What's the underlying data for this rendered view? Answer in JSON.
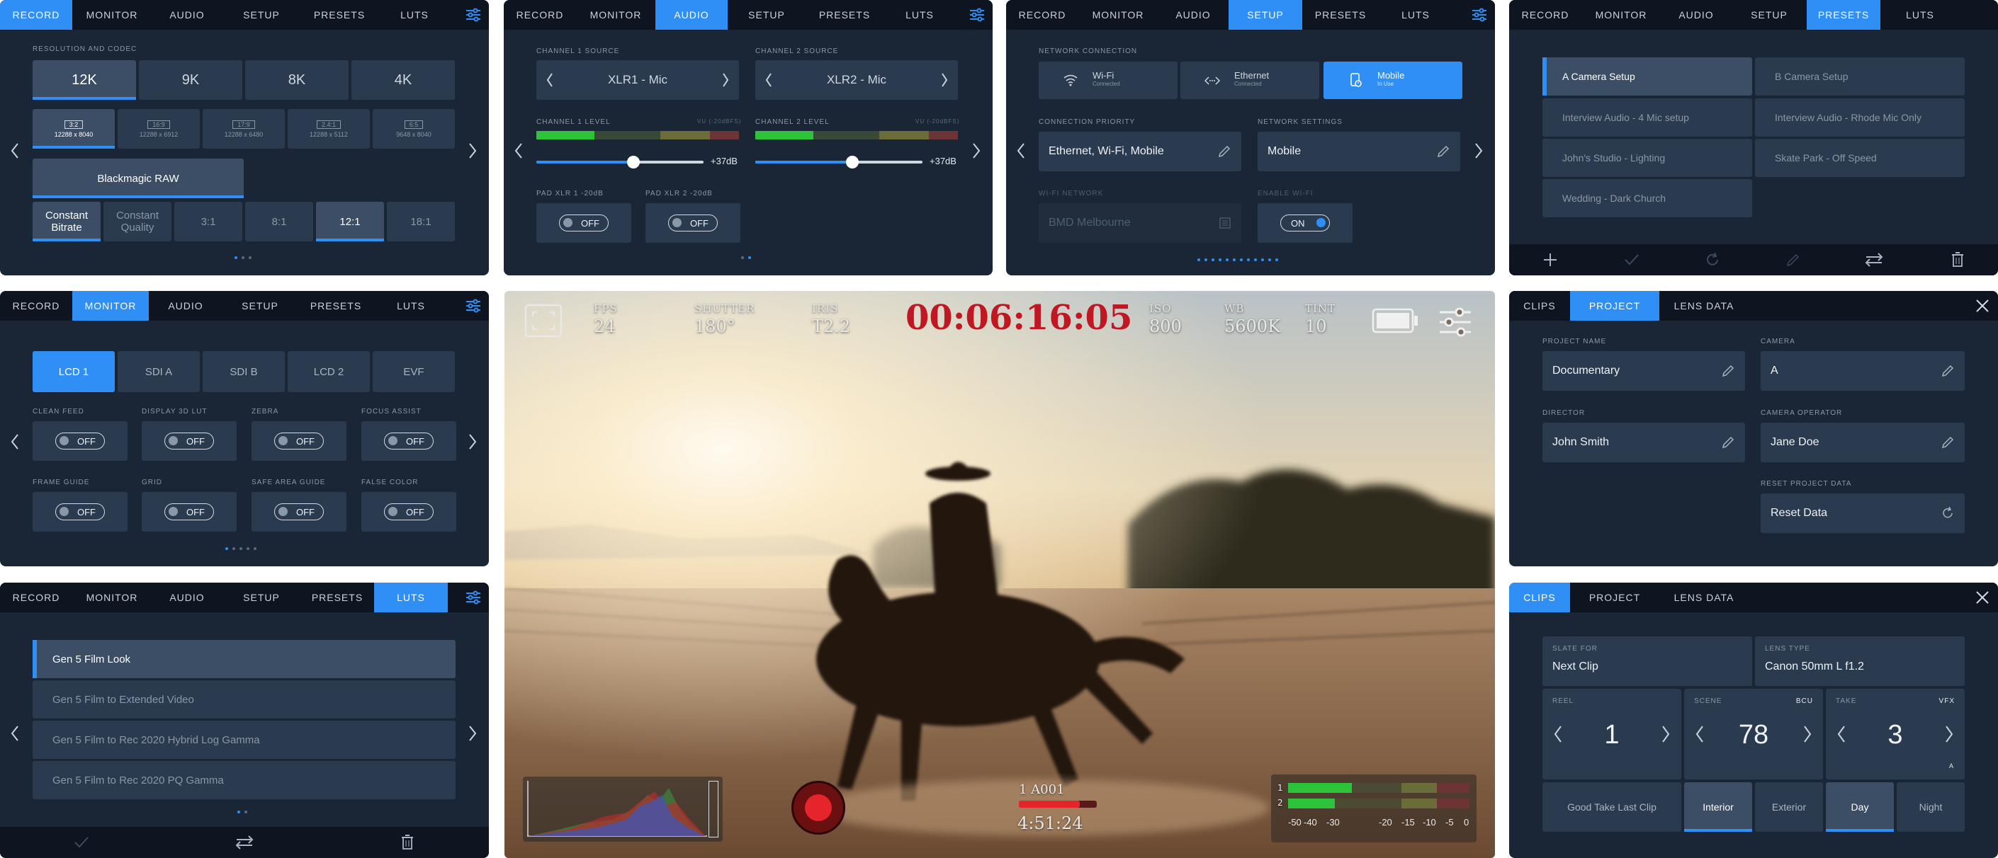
{
  "tabs_main": [
    "RECORD",
    "MONITOR",
    "AUDIO",
    "SETUP",
    "PRESETS",
    "LUTS"
  ],
  "record": {
    "section_label": "RESOLUTION AND CODEC",
    "resolutions": [
      "12K",
      "9K",
      "8K",
      "4K"
    ],
    "aspect_ratios": [
      {
        "ratio": "3:2",
        "size": "12288 x 8040"
      },
      {
        "ratio": "16:9",
        "size": "12288 x 6912"
      },
      {
        "ratio": "17:9",
        "size": "12288 x 6480"
      },
      {
        "ratio": "2.4:1",
        "size": "12288 x 5112"
      },
      {
        "ratio": "6:5",
        "size": "9648 x 8040"
      }
    ],
    "codec": "Blackmagic RAW",
    "quality": [
      "Constant Bitrate",
      "Constant Quality",
      "3:1",
      "8:1",
      "12:1",
      "18:1"
    ]
  },
  "audio": {
    "ch1_source_label": "CHANNEL 1 SOURCE",
    "ch2_source_label": "CHANNEL 2 SOURCE",
    "ch1_source": "XLR1 - Mic",
    "ch2_source": "XLR2 - Mic",
    "ch1_level_label": "CHANNEL 1 LEVEL",
    "ch2_level_label": "CHANNEL 2 LEVEL",
    "vu_label": "VU (-20dBFS)",
    "ch1_gain": "+37dB",
    "ch2_gain": "+37dB",
    "ch1_level_fraction": 0.58,
    "ch2_level_fraction": 0.58,
    "pad1_label": "PAD XLR 1 -20dB",
    "pad2_label": "PAD XLR 2 -20dB",
    "pad1_state": "OFF",
    "pad2_state": "OFF"
  },
  "setup": {
    "network_label": "NETWORK CONNECTION",
    "connections": [
      {
        "name": "Wi-Fi",
        "status": "Connected"
      },
      {
        "name": "Ethernet",
        "status": "Connected"
      },
      {
        "name": "Mobile",
        "status": "In Use"
      }
    ],
    "priority_label": "CONNECTION PRIORITY",
    "priority_value": "Ethernet, Wi-Fi, Mobile",
    "net_settings_label": "NETWORK SETTINGS",
    "net_settings_value": "Mobile",
    "wifi_network_label": "WI-FI NETWORK",
    "wifi_network_value": "BMD Melbourne",
    "enable_wifi_label": "ENABLE WI-FI",
    "enable_wifi_state": "ON"
  },
  "presets": {
    "items": [
      "A Camera Setup",
      "B Camera Setup",
      "Interview Audio - 4 Mic setup",
      "Interview Audio - Rhode Mic Only",
      "John's Studio - Lighting",
      "Skate Park - Off Speed",
      "Wedding  - Dark Church"
    ]
  },
  "monitor": {
    "outputs": [
      "LCD 1",
      "SDI A",
      "SDI B",
      "LCD 2",
      "EVF"
    ],
    "toggles": [
      {
        "label": "CLEAN FEED",
        "state": "OFF"
      },
      {
        "label": "DISPLAY 3D LUT",
        "state": "OFF"
      },
      {
        "label": "ZEBRA",
        "state": "OFF"
      },
      {
        "label": "FOCUS ASSIST",
        "state": "OFF"
      },
      {
        "label": "FRAME GUIDE",
        "state": "OFF"
      },
      {
        "label": "GRID",
        "state": "OFF"
      },
      {
        "label": "SAFE AREA GUIDE",
        "state": "OFF"
      },
      {
        "label": "FALSE COLOR",
        "state": "OFF"
      }
    ]
  },
  "luts": {
    "items": [
      "Gen 5 Film Look",
      "Gen 5 Film to Extended Video",
      "Gen 5 Film to Rec 2020 Hybrid Log Gamma",
      "Gen 5 Film to Rec 2020 PQ Gamma"
    ]
  },
  "viewfinder": {
    "fps_label": "FPS",
    "fps": "24",
    "shutter_label": "SHUTTER",
    "shutter": "180°",
    "iris_label": "IRIS",
    "iris": "T2.2",
    "timecode": "00:06:16:05",
    "iso_label": "ISO",
    "iso": "800",
    "wb_label": "WB",
    "wb": "5600K",
    "tint_label": "TINT",
    "tint": "10",
    "clip_name": "1  A001",
    "record_remaining": "4:51:24",
    "meter_ch1": "1",
    "meter_ch2": "2",
    "meter_scale": [
      "-50",
      "-40",
      "-30",
      "-20",
      "-15",
      "-10",
      "-5",
      "0"
    ]
  },
  "project": {
    "tabs": [
      "CLIPS",
      "PROJECT",
      "LENS DATA"
    ],
    "project_name_label": "PROJECT NAME",
    "project_name": "Documentary",
    "camera_label": "CAMERA",
    "camera": "A",
    "director_label": "DIRECTOR",
    "director": "John Smith",
    "operator_label": "CAMERA OPERATOR",
    "operator": "Jane Doe",
    "reset_label": "RESET PROJECT DATA",
    "reset_button": "Reset Data"
  },
  "clips": {
    "tabs": [
      "CLIPS",
      "PROJECT",
      "LENS DATA"
    ],
    "slate_for_label": "SLATE FOR",
    "slate_for": "Next Clip",
    "lens_type_label": "LENS TYPE",
    "lens_type": "Canon 50mm L f1.2",
    "reel_label": "REEL",
    "reel": "1",
    "scene_label": "SCENE",
    "scene_tag": "BCU",
    "scene": "78",
    "take_label": "TAKE",
    "take_tag": "VFX",
    "take": "3",
    "take_sub": "A",
    "good_take": "Good Take Last Clip",
    "interior": "Interior",
    "exterior": "Exterior",
    "day": "Day",
    "night": "Night"
  }
}
